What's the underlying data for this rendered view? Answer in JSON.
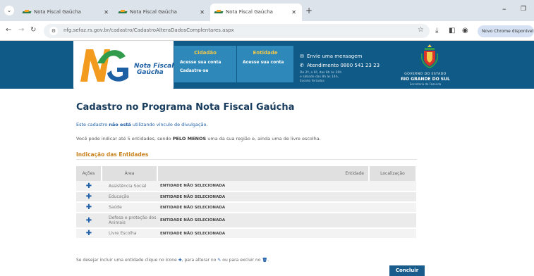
{
  "browser": {
    "tabs": [
      {
        "title": "Nota Fiscal Gaúcha"
      },
      {
        "title": "Nota Fiscal Gaúcha"
      },
      {
        "title": "Nota Fiscal Gaúcha"
      }
    ],
    "url": "nfg.sefaz.rs.gov.br/cadastro/CadastroAlteraDadosComplentares.aspx",
    "profile_label": "Novo Chrome disponível"
  },
  "header": {
    "logo_text_1": "Nota Fiscal",
    "logo_text_2": "Gaúcha",
    "cidadao": {
      "title": "Cidadão",
      "line1": "Acesse sua conta",
      "line2": "Cadastre-se"
    },
    "entidade": {
      "title": "Entidade",
      "line1": "Acesse sua conta"
    },
    "contact": {
      "message": "Envie uma mensagem",
      "phone": "Atendimento 0800 541 23 23",
      "hours1": "De 2ª, a 6ª, das 8h às 20h",
      "hours2": "e sábado das 8h às 14h,",
      "hours3": "Exceto feriados"
    },
    "gov": {
      "line1": "GOVERNO DO ESTADO",
      "line2": "RIO GRANDE DO SUL",
      "line3": "Secretaria da Fazenda"
    }
  },
  "main": {
    "title": "Cadastro no Programa Nota Fiscal Gaúcha",
    "info1_pre": "Este cadastro",
    "info1_bold": "não está",
    "info1_post": "utilizando vínculo de divulgação.",
    "info2_pre": "Você pode indicar até 5 entidades, sendo",
    "info2_bold": "PELO MENOS",
    "info2_post": "uma da sua região e, ainda uma de livre escolha.",
    "section_title": "Indicação das Entidades",
    "table": {
      "headers": [
        "Ações",
        "Área",
        "Entidade",
        "Localização"
      ],
      "rows": [
        {
          "area": "Assistência Social",
          "entity": "ENTIDADE NÃO SELECIONADA"
        },
        {
          "area": "Educação",
          "entity": "ENTIDADE NÃO SELECIONADA"
        },
        {
          "area": "Saúde",
          "entity": "ENTIDADE NÃO SELECIONADA"
        },
        {
          "area": "Defesa e proteção dos Animais",
          "entity": "ENTIDADE NÃO SELECIONADA"
        },
        {
          "area": "Livre Escolha",
          "entity": "ENTIDADE NÃO SELECIONADA"
        }
      ]
    },
    "hint_1": "Se desejar incluir uma entidade clique no ícone",
    "hint_2": ", para alterar no",
    "hint_3": "ou para excluir no",
    "hint_end": ".",
    "submit_label": "Concluir"
  }
}
